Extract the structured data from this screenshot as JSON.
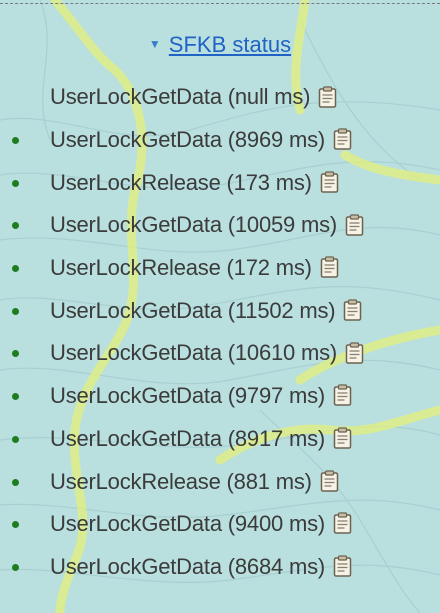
{
  "panel": {
    "title": "SFKB status",
    "chevron_icon": "chevron-down-icon"
  },
  "colors": {
    "background": "#b9dfdf",
    "link": "#1f63c6",
    "bullet": "#1e7d1e",
    "trail": "#e4f07a"
  },
  "entries": [
    {
      "label": "UserLockGetData (null ms)",
      "bullet": false,
      "icon": "clipboard-icon"
    },
    {
      "label": "UserLockGetData (8969 ms)",
      "bullet": true,
      "icon": "clipboard-icon"
    },
    {
      "label": "UserLockRelease (173 ms)",
      "bullet": true,
      "icon": "clipboard-icon"
    },
    {
      "label": "UserLockGetData (10059 ms)",
      "bullet": true,
      "icon": "clipboard-icon"
    },
    {
      "label": "UserLockRelease (172 ms)",
      "bullet": true,
      "icon": "clipboard-icon"
    },
    {
      "label": "UserLockGetData (11502 ms)",
      "bullet": true,
      "icon": "clipboard-icon"
    },
    {
      "label": "UserLockGetData (10610 ms)",
      "bullet": true,
      "icon": "clipboard-icon"
    },
    {
      "label": "UserLockGetData (9797 ms)",
      "bullet": true,
      "icon": "clipboard-icon"
    },
    {
      "label": "UserLockGetData (8917 ms)",
      "bullet": true,
      "icon": "clipboard-icon"
    },
    {
      "label": "UserLockRelease (881 ms)",
      "bullet": true,
      "icon": "clipboard-icon"
    },
    {
      "label": "UserLockGetData (9400 ms)",
      "bullet": true,
      "icon": "clipboard-icon"
    },
    {
      "label": "UserLockGetData (8684 ms)",
      "bullet": true,
      "icon": "clipboard-icon"
    }
  ]
}
